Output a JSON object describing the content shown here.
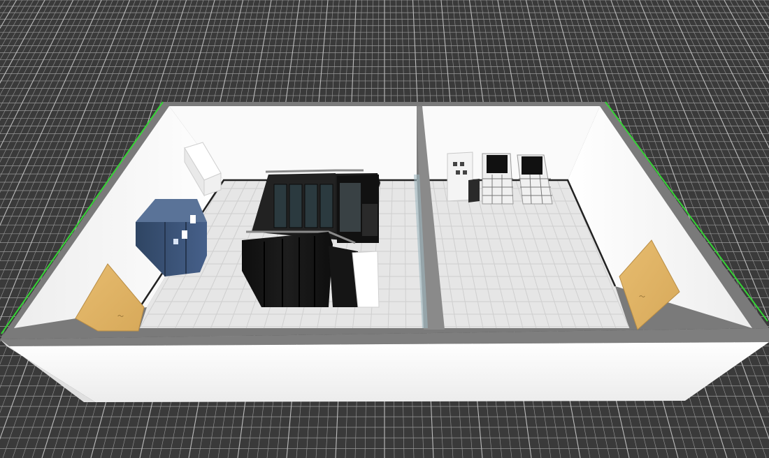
{
  "app": {
    "view": "3d-floor-plan"
  },
  "scene": {
    "background_color": "#3a3a3a",
    "grid_line_color": "#9a9a9a",
    "grid_major_color": "#bdbdbd",
    "floor_color": "#e6e6e6",
    "floor_tile_line_color": "#cfcfcf",
    "wall_face_color": "#f4f4f4",
    "wall_top_color": "#7a7a7a",
    "selection_outline_color": "#35d435",
    "rooms": [
      {
        "name": "room-left",
        "equipment": [
          "precooling-ac-unit",
          "power-distribution-cabinet",
          "server-rack-row",
          "door-left"
        ]
      },
      {
        "name": "room-right",
        "equipment": [
          "electrical-panel",
          "battery-rack",
          "battery-rack",
          "door-right"
        ]
      }
    ],
    "equipment_colors": {
      "rack": "#141414",
      "rack_glass": "#2b3a3f",
      "ac_unit": "#ffffff",
      "distribution_cabinet": "#3a5172",
      "door": "#e0b467",
      "battery_rack": "#f0f0f0"
    }
  }
}
